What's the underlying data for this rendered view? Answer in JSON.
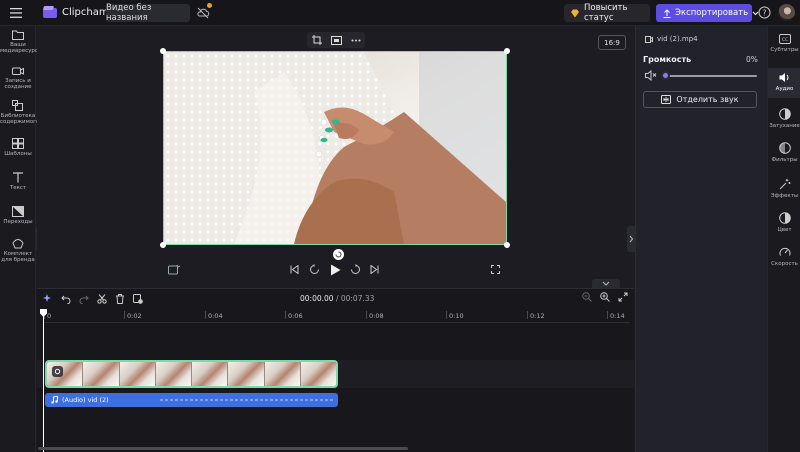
{
  "app": {
    "title": "Clipchamp",
    "video_title": "Видео без названия"
  },
  "header": {
    "upgrade_label": "Повысить статус",
    "export_label": "Экспортировать",
    "accent": "#5b4de0"
  },
  "left_sidebar": {
    "items": [
      {
        "label": "Ваши медиаресурсы",
        "icon": "folder-icon"
      },
      {
        "label": "Запись и создание",
        "icon": "camera-icon"
      },
      {
        "label": "Библиотека содержимого",
        "icon": "library-icon"
      },
      {
        "label": "Шаблоны",
        "icon": "templates-icon"
      },
      {
        "label": "Текст",
        "icon": "text-icon"
      },
      {
        "label": "Переходы",
        "icon": "transitions-icon"
      },
      {
        "label": "Комплект для бренда",
        "icon": "brand-kit-icon"
      }
    ]
  },
  "preview": {
    "aspect_ratio": "16:9",
    "toolbar": [
      "crop-icon",
      "fit-icon",
      "more-icon"
    ]
  },
  "timeline": {
    "current_time": "00:00.00",
    "total_time": "/ 00:07.33",
    "ticks": [
      "0",
      "0:02",
      "0:04",
      "0:06",
      "0:08",
      "0:10",
      "0:12",
      "0:14"
    ],
    "audio_clip_label": "(Audio) vid (2)",
    "clip_border_color": "#7fd8a8",
    "audio_color": "#3d6fe0"
  },
  "properties": {
    "file_name": "vid (2).mp4",
    "volume_label": "Громкость",
    "volume_value": "0%",
    "volume_level": 0,
    "detach_label": "Отделить звук"
  },
  "right_sidebar": {
    "items": [
      {
        "label": "Субтитры",
        "icon": "captions-icon"
      },
      {
        "label": "Аудио",
        "icon": "audio-icon",
        "active": true
      },
      {
        "label": "Затухание",
        "icon": "fade-icon"
      },
      {
        "label": "Фильтры",
        "icon": "filters-icon"
      },
      {
        "label": "Эффекты",
        "icon": "effects-icon"
      },
      {
        "label": "Цвет",
        "icon": "color-icon"
      },
      {
        "label": "Скорость",
        "icon": "speed-icon"
      }
    ]
  }
}
